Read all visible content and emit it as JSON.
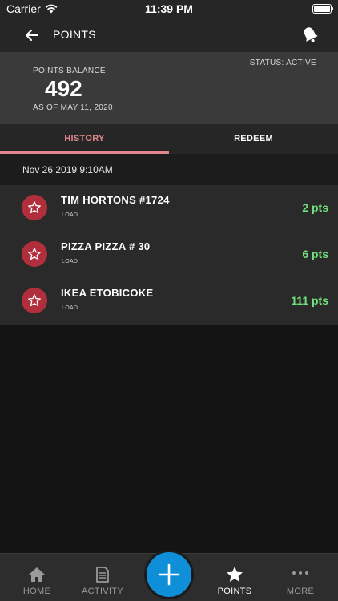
{
  "status_bar": {
    "carrier": "Carrier",
    "time": "11:39 PM"
  },
  "header": {
    "title": "POINTS",
    "back_icon": "arrow-left-icon",
    "action_icon": "bell-icon"
  },
  "balance": {
    "label": "POINTS BALANCE",
    "value": "492",
    "as_of": "AS OF MAY 11, 2020",
    "status": "STATUS: ACTIVE"
  },
  "tabs": [
    {
      "label": "HISTORY",
      "active": true
    },
    {
      "label": "REDEEM",
      "active": false
    }
  ],
  "history": {
    "date": "Nov 26 2019  9:10AM",
    "items": [
      {
        "name": "TIM HORTONS #1724",
        "type": "LOAD",
        "points": "2 pts",
        "icon": "star-icon"
      },
      {
        "name": "PIZZA PIZZA # 30",
        "type": "LOAD",
        "points": "6 pts",
        "icon": "star-icon"
      },
      {
        "name": "IKEA ETOBICOKE",
        "type": "LOAD",
        "points": "111 pts",
        "icon": "star-icon"
      }
    ]
  },
  "colors": {
    "accent": "#e0868c",
    "badge": "#b12f3d",
    "points_green": "#71e27a",
    "fab": "#0f8fd8"
  },
  "tabbar": {
    "items": [
      {
        "label": "HOME",
        "icon": "home-icon"
      },
      {
        "label": "ACTIVITY",
        "icon": "document-icon"
      },
      {
        "label": "POINTS",
        "icon": "star-icon",
        "active": true
      },
      {
        "label": "MORE",
        "icon": "more-dots-icon"
      }
    ],
    "fab_icon": "plus-icon"
  }
}
